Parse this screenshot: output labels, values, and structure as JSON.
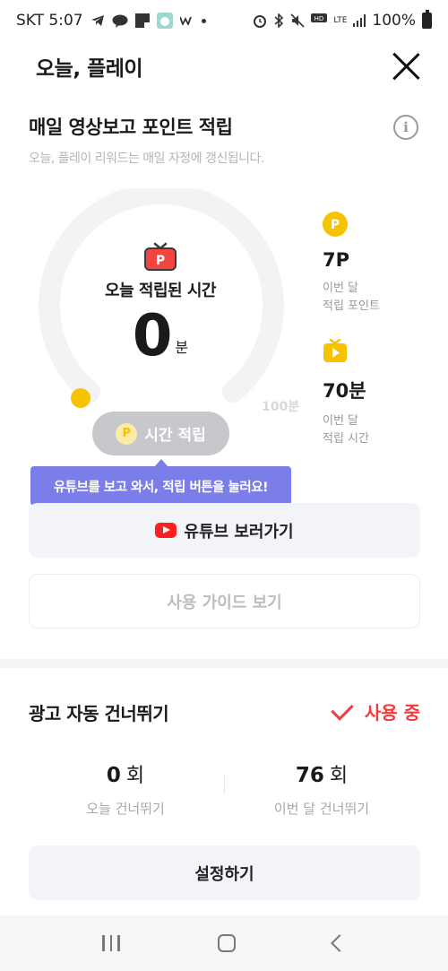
{
  "status_bar": {
    "carrier_time": "SKT 5:07",
    "battery": "100%",
    "lte": "LTE"
  },
  "header": {
    "title": "오늘, 플레이"
  },
  "section": {
    "title": "매일 영상보고 포인트 적립",
    "subtitle": "오늘, 플레이 리워드는 매일 자정에 갱신됩니다."
  },
  "gauge": {
    "label": "오늘 적립된 시간",
    "value": "0",
    "unit": "분",
    "max_label": "100분",
    "progress": 0
  },
  "claim_button": {
    "label": "시간 적립",
    "coin": "P"
  },
  "tooltip": {
    "text": "유튜브를 보고 와서, 적립 버튼을 눌러요!"
  },
  "stats": [
    {
      "icon": "point-coin-icon",
      "value": "7P",
      "label_line1": "이번 달",
      "label_line2": "적립 포인트"
    },
    {
      "icon": "play-tv-icon",
      "value": "70분",
      "label_line1": "이번 달",
      "label_line2": "적립 시간"
    }
  ],
  "youtube_button": {
    "label": "유튜브 보러가기"
  },
  "guide_button": {
    "label": "사용 가이드 보기"
  },
  "ad_skip": {
    "title": "광고 자동 건너뛰기",
    "status": "사용 중",
    "today_count": "0",
    "today_unit": "회",
    "today_label": "오늘 건너뛰기",
    "month_count": "76",
    "month_unit": "회",
    "month_label": "이번 달 건너뛰기",
    "settings_label": "설정하기"
  },
  "colors": {
    "accent_purple": "#7b7ee8",
    "accent_red": "#f23a3a",
    "coin_yellow": "#f6c300",
    "youtube_red": "#ff1f1f"
  }
}
